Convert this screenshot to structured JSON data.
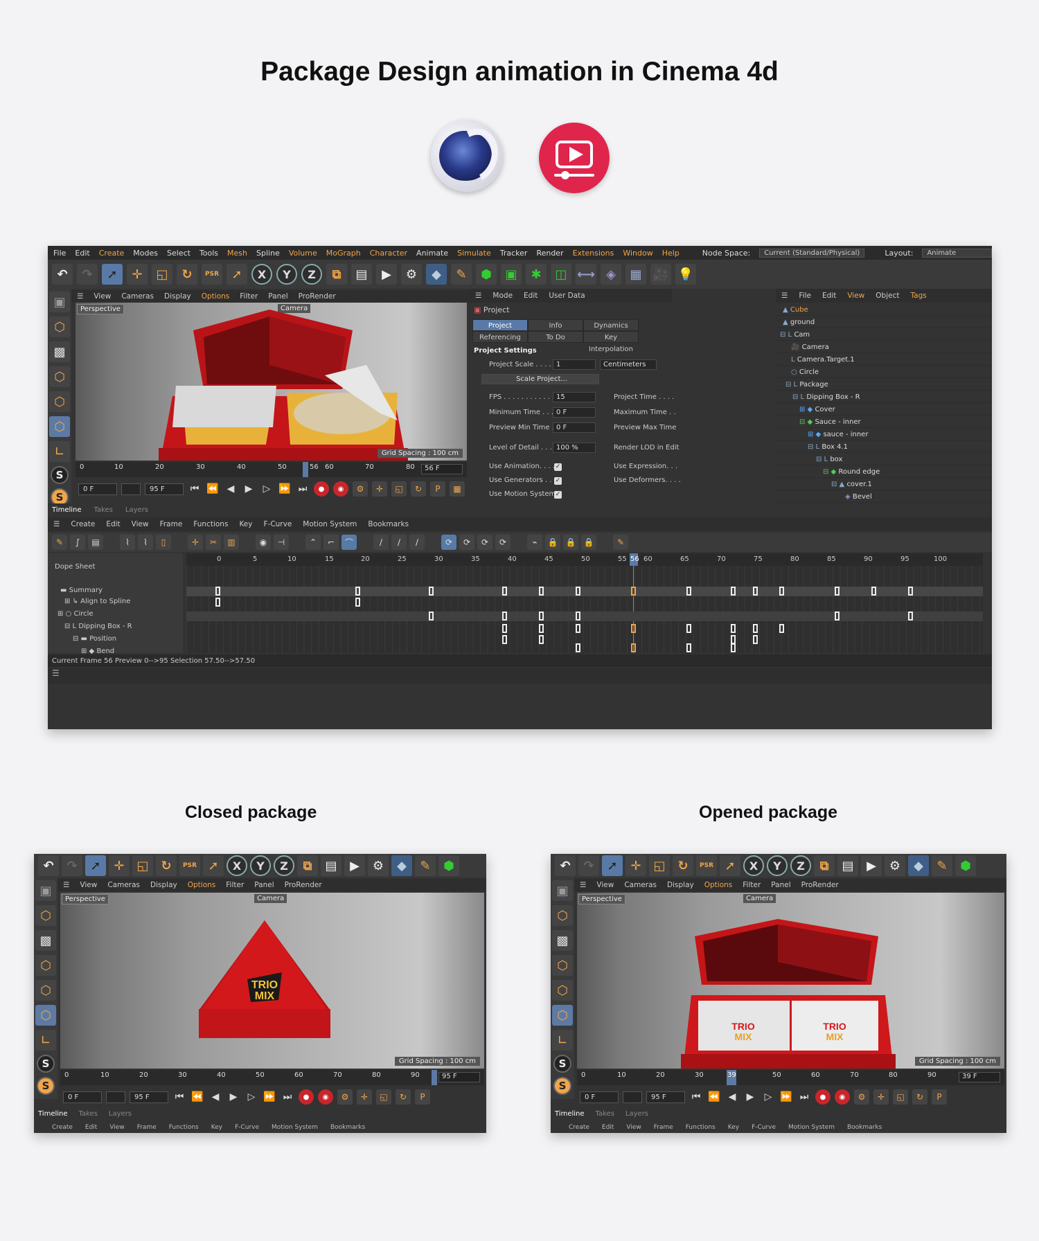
{
  "page_title": "Package Design animation in Cinema 4d",
  "logos": {
    "cinema4d": "cinema4d-logo",
    "video": "video-player-icon"
  },
  "main_window": {
    "menu": [
      "File",
      "Edit",
      "Create",
      "Modes",
      "Select",
      "Tools",
      "Mesh",
      "Spline",
      "Volume",
      "MoGraph",
      "Character",
      "Animate",
      "Simulate",
      "Tracker",
      "Render",
      "Extensions",
      "Window",
      "Help"
    ],
    "node_space_label": "Node Space:",
    "node_space_value": "Current (Standard/Physical)",
    "layout_label": "Layout:",
    "layout_value": "Animate",
    "viewport_menu": [
      "View",
      "Cameras",
      "Display",
      "Options",
      "Filter",
      "Panel",
      "ProRender"
    ],
    "perspective": "Perspective",
    "camera": "Camera",
    "grid_spacing": "Grid Spacing : 100 cm",
    "ruler_ticks": [
      "0",
      "10",
      "20",
      "30",
      "40",
      "50",
      "56",
      "60",
      "70",
      "80",
      "90"
    ],
    "current_frame_field": "56 F",
    "start_field": "0 F",
    "end_field": "95 F",
    "attr_menu": [
      "Mode",
      "Edit",
      "User Data"
    ],
    "attr_title": "Project",
    "attr_tabs": [
      "Project Settings",
      "Info",
      "Dynamics",
      "Referencing",
      "To Do",
      "Key Interpolation"
    ],
    "attr_section": "Project Settings",
    "project_scale_label": "Project Scale . . . . .",
    "project_scale_value": "1",
    "units": "Centimeters",
    "scale_project_btn": "Scale Project...",
    "fps_label": "FPS . . . . . . . . . . . .",
    "fps_value": "15",
    "min_time_label": "Minimum Time . . . .",
    "min_time_value": "0 F",
    "preview_min_label": "Preview Min Time . .",
    "preview_min_value": "0 F",
    "lod_label": "Level of Detail . . . .",
    "lod_value": "100 %",
    "project_time_label": "Project Time . . . .",
    "max_time_label": "Maximum Time . .",
    "preview_max_label": "Preview Max Time",
    "render_lod_label": "Render LOD in Edit",
    "use_animation": "Use Animation. . . .",
    "use_generators": "Use Generators . . .",
    "use_motion": "Use Motion System",
    "use_expression": "Use Expression. . .",
    "use_deformers": "Use Deformers. . . .",
    "obj_menu": [
      "File",
      "Edit",
      "View",
      "Object",
      "Tags"
    ],
    "objects": [
      "Cube",
      "ground",
      "Cam",
      "Camera",
      "Camera.Target.1",
      "Circle",
      "Package",
      "Dipping Box - R",
      "Cover",
      "Sauce - inner",
      "sauce - inner",
      "Box 4.1",
      "box",
      "Round edge",
      "cover.1",
      "Bevel"
    ],
    "tl_tabs": [
      "Timeline",
      "Takes",
      "Layers"
    ],
    "tl_menu": [
      "Create",
      "Edit",
      "View",
      "Frame",
      "Functions",
      "Key",
      "F-Curve",
      "Motion System",
      "Bookmarks"
    ],
    "dope_sheet": "Dope Sheet",
    "tl_ticks": [
      "0",
      "5",
      "10",
      "15",
      "20",
      "25",
      "30",
      "35",
      "40",
      "45",
      "50",
      "55",
      "56",
      "60",
      "65",
      "70",
      "75",
      "80",
      "85",
      "90",
      "95",
      "100"
    ],
    "tracks": [
      "Summary",
      "Align to Spline",
      "Circle",
      "Dipping Box - R",
      "Position",
      "Bend"
    ],
    "status": "Current Frame  56  Preview  0-->95   Selection 57.50-->57.50"
  },
  "closed": {
    "caption": "Closed package",
    "viewport_menu": [
      "View",
      "Cameras",
      "Display",
      "Options",
      "Filter",
      "Panel",
      "ProRender"
    ],
    "perspective": "Perspective",
    "camera": "Camera",
    "grid_spacing": "Grid Spacing : 100 cm",
    "ruler_ticks": [
      "0",
      "10",
      "20",
      "30",
      "40",
      "50",
      "60",
      "70",
      "80",
      "90"
    ],
    "frame_field": "95 F",
    "start_field": "0 F",
    "end_field": "95 F",
    "tl_tabs": [
      "Timeline",
      "Takes",
      "Layers"
    ],
    "tl_menu": [
      "Create",
      "Edit",
      "View",
      "Frame",
      "Functions",
      "Key",
      "F-Curve",
      "Motion System",
      "Bookmarks"
    ],
    "brand_line1": "TRIO",
    "brand_line2": "MIX"
  },
  "opened": {
    "caption": "Opened package",
    "viewport_menu": [
      "View",
      "Cameras",
      "Display",
      "Options",
      "Filter",
      "Panel",
      "ProRender"
    ],
    "perspective": "Perspective",
    "camera": "Camera",
    "grid_spacing": "Grid Spacing : 100 cm",
    "ruler_ticks": [
      "0",
      "10",
      "20",
      "30",
      "39",
      "50",
      "60",
      "70",
      "80",
      "90"
    ],
    "frame_field": "39 F",
    "start_field": "0 F",
    "end_field": "95 F",
    "tl_tabs": [
      "Timeline",
      "Takes",
      "Layers"
    ],
    "tl_menu": [
      "Create",
      "Edit",
      "View",
      "Frame",
      "Functions",
      "Key",
      "F-Curve",
      "Motion System",
      "Bookmarks"
    ],
    "brand_line1": "TRIO",
    "brand_line2": "MIX"
  },
  "colors": {
    "accent": "#f0a54a",
    "selection": "#597aa6",
    "package_red": "#d3181b"
  }
}
